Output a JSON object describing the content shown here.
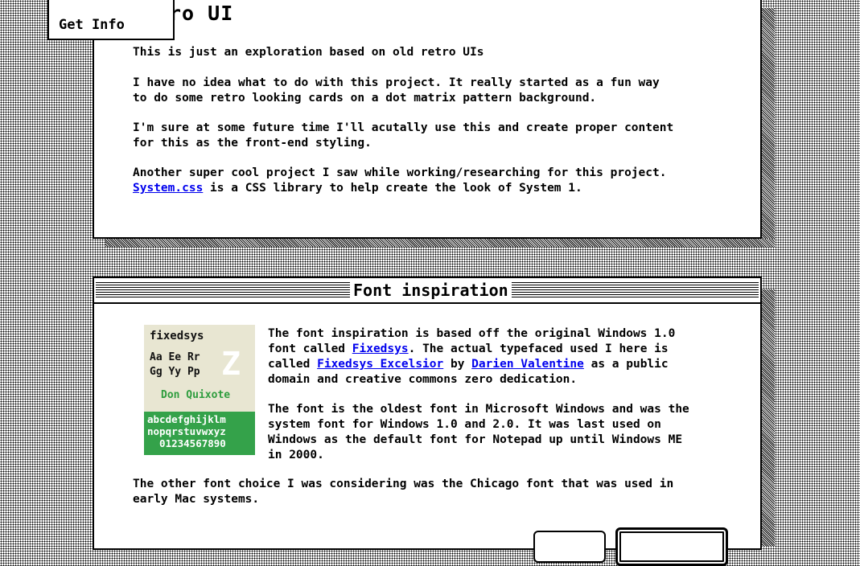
{
  "window1": {
    "title_visible": "ro UI",
    "subtitle": "This is just an exploration based on old retro UIs",
    "para1": "I have no idea what to do with this project. It really started as a fun way\nto do some retro looking cards on a dot matrix pattern background.",
    "para2": "I'm sure at some future time I'll acutally use this and create proper content\nfor this as the front-end styling.",
    "para3_line1": "Another super cool project I saw while working/researching for this project.",
    "para3_link": "System.css",
    "para3_rest": " is a CSS library to help create the look of System 1."
  },
  "menu": {
    "item_partial": "•",
    "item_get_info": "Get Info"
  },
  "window2": {
    "title": "Font inspiration",
    "sample": {
      "name": "fixedsys",
      "pairs": "Aa Ee Rr\nGg Yy Pp",
      "big_letter": "Z",
      "quixote": "Don Quixote",
      "alphabet": "abcdefghijklm\nnopqrstuvwxyz\n  01234567890"
    },
    "p1_a": "The font inspiration is based off the original Windows 1.0\nfont called ",
    "p1_link1": "Fixedsys",
    "p1_b": ". The actual typefaced used I here is\ncalled ",
    "p1_link2": "Fixedsys Excelsior",
    "p1_c": " by ",
    "p1_link3": "Darien Valentine",
    "p1_d": " as a public\ndomain and creative commons zero dedication.",
    "p2": "The font is the oldest font in Microsoft Windows and was the\nsystem font for Windows 1.0 and 2.0. It was last used on\nWindows as the default font for Notepad up until Windows ME\nin 2000.",
    "p3": "The other font choice I was considering was the Chicago font that was used in\nearly Mac systems."
  }
}
